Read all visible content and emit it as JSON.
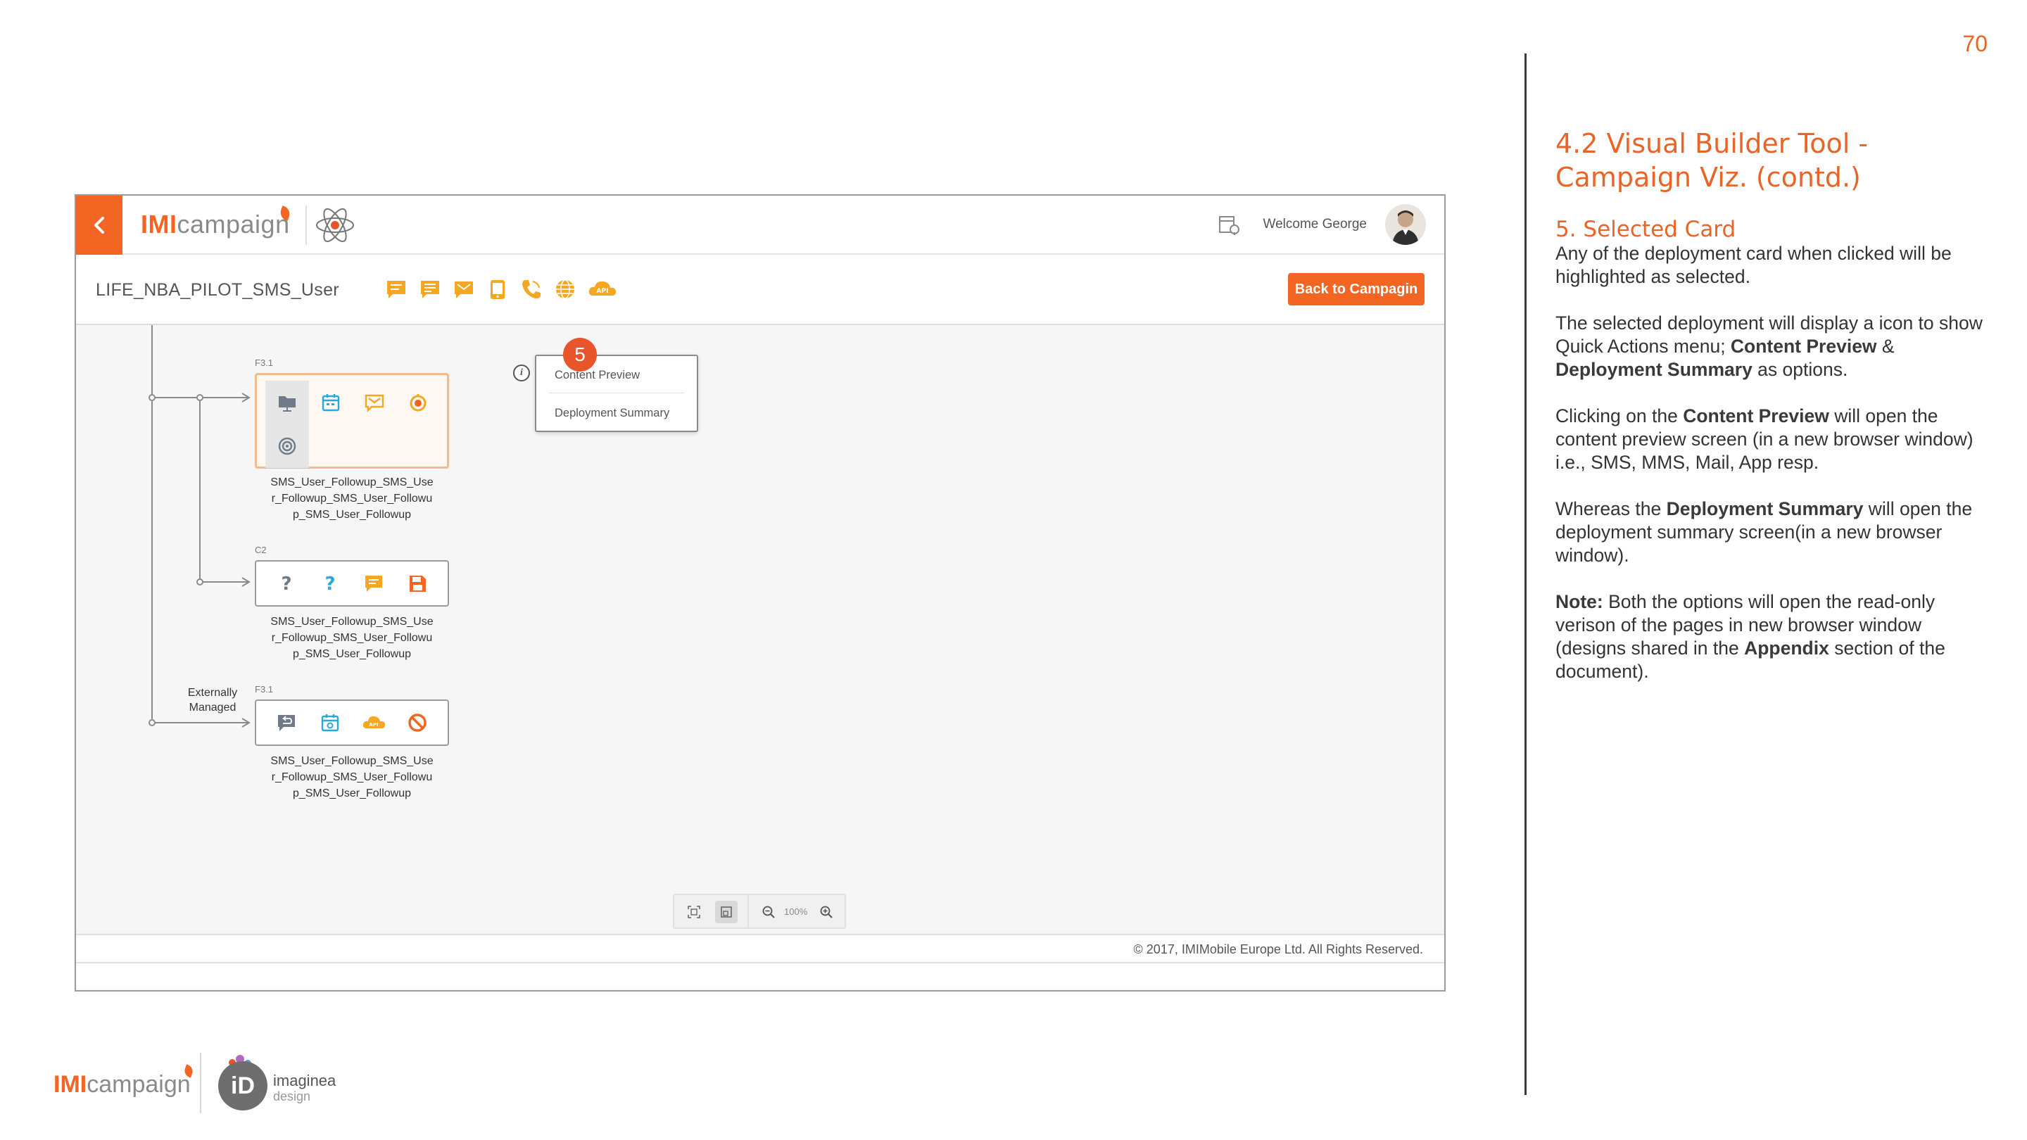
{
  "page_number": "70",
  "notes": {
    "heading": "4.2 Visual Builder Tool - Campaign Viz. (contd.)",
    "section_title": "5. Selected Card",
    "para1": "Any of the deployment card when clicked will be highlighted as selected.",
    "para2_a": "The selected deployment will display a icon to show Quick Actions menu; ",
    "para2_b": "Content Preview",
    "para2_c": " & ",
    "para2_d": "Deployment Summary",
    "para2_e": " as options.",
    "para3_a": "Clicking on the ",
    "para3_b": "Content Preview",
    "para3_c": " will open the content preview screen (in a new browser window) i.e., SMS, MMS, Mail, App resp.",
    "para4_a": "Whereas the ",
    "para4_b": "Deployment Summary",
    "para4_c": " will open the deployment summary screen(in a new browser window).",
    "para5_a": "Note:",
    "para5_b": " Both the options will open the read-only verison of the pages in new browser window (designs shared in the ",
    "para5_c": "Appendix",
    "para5_d": " section of the document)."
  },
  "app": {
    "brand_imi": "IMI",
    "brand_rest": "campaign",
    "welcome": "Welcome George",
    "campaign_name": "LIFE_NBA_PILOT_SMS_User",
    "back_to_campaign": "Back to Campagin",
    "channel_icons": [
      "sms-icon",
      "sms-list-icon",
      "mail-icon",
      "app-icon",
      "voice-icon",
      "web-icon",
      "api-icon"
    ],
    "cards": [
      {
        "stage": "F3.1",
        "selected": true,
        "icons": [
          "folder-icon",
          "calendar-icon",
          "mail-icon",
          "timer-icon",
          "target-icon"
        ],
        "title": [
          "SMS_User_Followup_SMS_Use",
          "r_Followup_SMS_User_Followu",
          "p_SMS_User_Followup"
        ]
      },
      {
        "stage": "C2",
        "selected": false,
        "icons": [
          "question-icon",
          "question-icon",
          "sms-icon",
          "save-icon"
        ],
        "title": [
          "SMS_User_Followup_SMS_Use",
          "r_Followup_SMS_User_Followu",
          "p_SMS_User_Followup"
        ]
      },
      {
        "stage": "F3.1",
        "selected": false,
        "icons": [
          "reply-icon",
          "calendar-gear-icon",
          "api-icon",
          "block-icon"
        ],
        "title": [
          "SMS_User_Followup_SMS_Use",
          "r_Followup_SMS_User_Followu",
          "p_SMS_User_Followup"
        ]
      }
    ],
    "quick_actions": [
      "Content Preview",
      "Deployment Summary"
    ],
    "step_badge": "5",
    "externally_managed": [
      "Externally",
      "Managed"
    ],
    "zoom": "100%",
    "footer": "© 2017, IMIMobile Europe Ltd. All Rights Reserved."
  },
  "footer_logos": {
    "imi": "IMI",
    "campaign": "campaign",
    "id_mark": "iD",
    "imaginea": "imaginea",
    "design": "design"
  },
  "colors": {
    "accent": "#f26522",
    "heading": "#e8652a",
    "icon_orange": "#f5a623",
    "icon_blue": "#29a8e0"
  }
}
